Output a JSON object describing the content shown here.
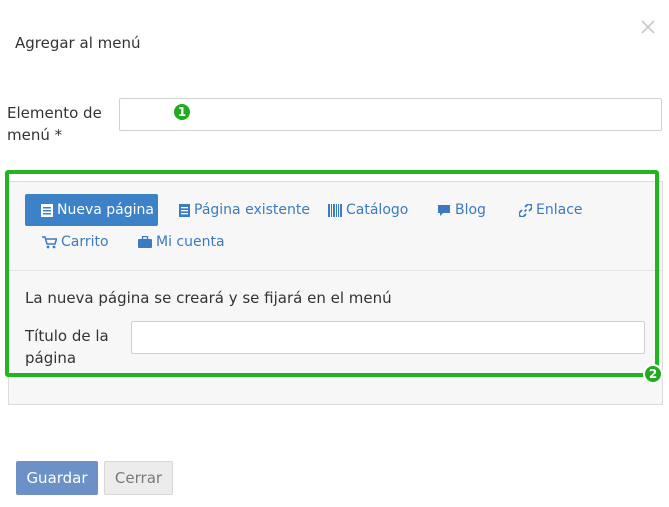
{
  "dialog": {
    "title": "Agregar al menú",
    "close_icon": "close-icon"
  },
  "menu_item_field": {
    "label": "Elemento de menú *",
    "value": "",
    "badge": "1"
  },
  "tabs": [
    {
      "label": "Nueva página",
      "icon": "page-icon",
      "active": true
    },
    {
      "label": "Página existente",
      "icon": "document-list-icon",
      "active": false
    },
    {
      "label": "Catálogo",
      "icon": "catalog-icon",
      "active": false
    },
    {
      "label": "Blog",
      "icon": "comment-icon",
      "active": false
    },
    {
      "label": "Enlace",
      "icon": "link-icon",
      "active": false
    },
    {
      "label": "Carrito",
      "icon": "cart-icon",
      "active": false
    },
    {
      "label": "Mi cuenta",
      "icon": "briefcase-icon",
      "active": false
    }
  ],
  "new_page": {
    "description": "La nueva página se creará y se fijará en el menú",
    "title_label": "Título de la página",
    "title_value": ""
  },
  "highlight_badge": "2",
  "footer": {
    "save_label": "Guardar",
    "close_label": "Cerrar"
  },
  "colors": {
    "accent": "#3d81c7",
    "link": "#3b7bbf",
    "highlight": "#21b51f",
    "save_button": "#6b91c6"
  }
}
